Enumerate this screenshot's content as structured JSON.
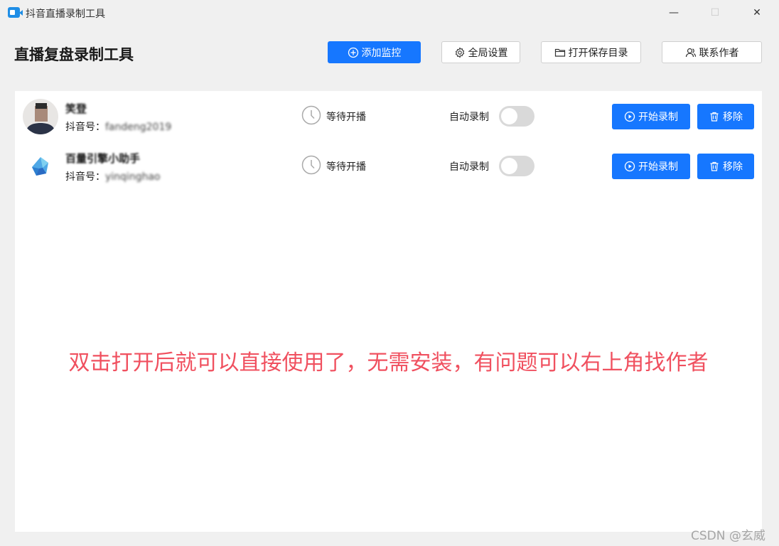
{
  "window": {
    "title": "抖音直播录制工具",
    "minimize": "—",
    "maximize": "☐",
    "close": "✕"
  },
  "header": {
    "title": "直播复盘录制工具",
    "buttons": [
      {
        "label": "添加监控",
        "icon": "plus-circle-icon",
        "style": "primary"
      },
      {
        "label": "全局设置",
        "icon": "gear-icon",
        "style": "default"
      },
      {
        "label": "打开保存目录",
        "icon": "folder-icon",
        "style": "default"
      },
      {
        "label": "联系作者",
        "icon": "users-icon",
        "style": "default"
      }
    ]
  },
  "streamers": [
    {
      "name": "笑登",
      "id_label": "抖音号：",
      "id_value": "fandeng2019",
      "status": "等待开播",
      "auto_record_label": "自动录制",
      "auto_record": false,
      "start_label": "开始录制",
      "remove_label": "移除"
    },
    {
      "name": "百量引擎小助手",
      "id_label": "抖音号：",
      "id_value": "yinqinghao",
      "status": "等待开播",
      "auto_record_label": "自动录制",
      "auto_record": false,
      "start_label": "开始录制",
      "remove_label": "移除"
    }
  ],
  "notice": "双击打开后就可以直接使用了，无需安装，有问题可以右上角找作者",
  "watermark": "CSDN @玄威",
  "colors": {
    "primary": "#1677ff",
    "notice": "#f0505f",
    "toggle_off": "#d9d9d9"
  }
}
